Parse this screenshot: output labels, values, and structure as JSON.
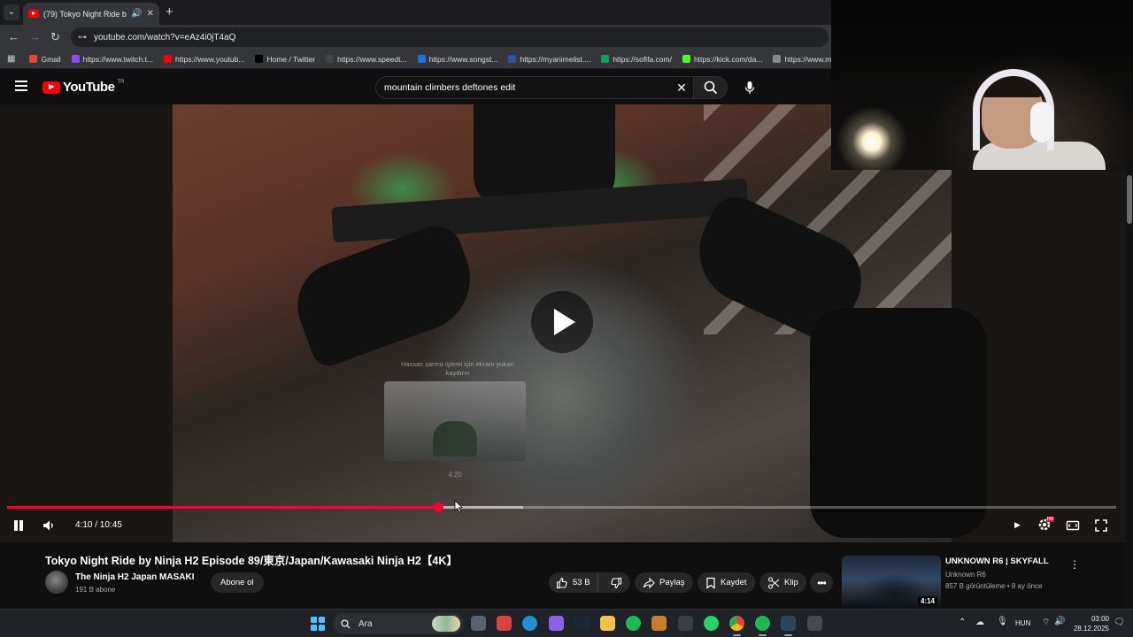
{
  "browser": {
    "tab_title": "(79) Tokyo Night Ride by Ni",
    "url": "youtube.com/watch?v=eAz4i0jT4aQ",
    "bookmarks": [
      {
        "label": "Gmail",
        "color": "#ea4335"
      },
      {
        "label": "https://www.twitch.t...",
        "color": "#9146ff"
      },
      {
        "label": "https://www.youtub...",
        "color": "#ff0000"
      },
      {
        "label": "Home / Twitter",
        "color": "#000000"
      },
      {
        "label": "https://www.speedt...",
        "color": "#444444"
      },
      {
        "label": "https://www.songst...",
        "color": "#1a73e8"
      },
      {
        "label": "https://myanimelist....",
        "color": "#2e51a2"
      },
      {
        "label": "https://sofifa.com/",
        "color": "#00a651"
      },
      {
        "label": "https://kick.com/da...",
        "color": "#53fc18"
      },
      {
        "label": "https://www.ma",
        "color": "#888888"
      }
    ]
  },
  "youtube": {
    "logo_text": "YouTube",
    "region": "TR",
    "search_query": "mountain climbers deftones edit"
  },
  "player": {
    "hint_line1": "Hassas sarma işlemi için ekranı yukarı",
    "hint_line2": "kaydırın",
    "preview_time": "4:20",
    "time_display": "4:10 / 10:45",
    "progress_played": 0.389,
    "progress_buffered": 0.465,
    "hd_badge": "HD"
  },
  "video": {
    "title": "Tokyo Night Ride by Ninja H2 Episode 89/東京/Japan/Kawasaki Ninja H2【4K】",
    "channel_name": "The Ninja H2 Japan MASAKI",
    "subscribers": "191 B abone",
    "subscribe_label": "Abone ol",
    "likes": "53 B",
    "share_label": "Paylaş",
    "save_label": "Kaydet",
    "clip_label": "Klip"
  },
  "recommendation": {
    "title": "UNKNOWN R6 | SKYFALL",
    "channel": "Unknown R6",
    "meta": "857 B görüntüleme • 8 ay önce",
    "duration": "4:14"
  },
  "taskbar": {
    "search_label": "Ara",
    "language": "HUN",
    "time": "03:00",
    "date": "28.12.2025",
    "apps": [
      {
        "name": "file-explorer",
        "color": "#5a6270"
      },
      {
        "name": "chrome-alt",
        "color": "#d8433d"
      },
      {
        "name": "edge",
        "color": "#1f8fd6"
      },
      {
        "name": "copilot",
        "color": "#8a62e6"
      },
      {
        "name": "steam",
        "color": "#1b2838"
      },
      {
        "name": "folder",
        "color": "#f2c14e"
      },
      {
        "name": "spotify",
        "color": "#1db954"
      },
      {
        "name": "editor",
        "color": "#c77d2e"
      },
      {
        "name": "store",
        "color": "#3a3f47"
      },
      {
        "name": "whatsapp",
        "color": "#25d366"
      },
      {
        "name": "chrome",
        "color": "#e8453c"
      },
      {
        "name": "spotify-2",
        "color": "#1db954"
      },
      {
        "name": "steam-2",
        "color": "#2a475e"
      },
      {
        "name": "system-tool",
        "color": "#444a52"
      }
    ]
  }
}
